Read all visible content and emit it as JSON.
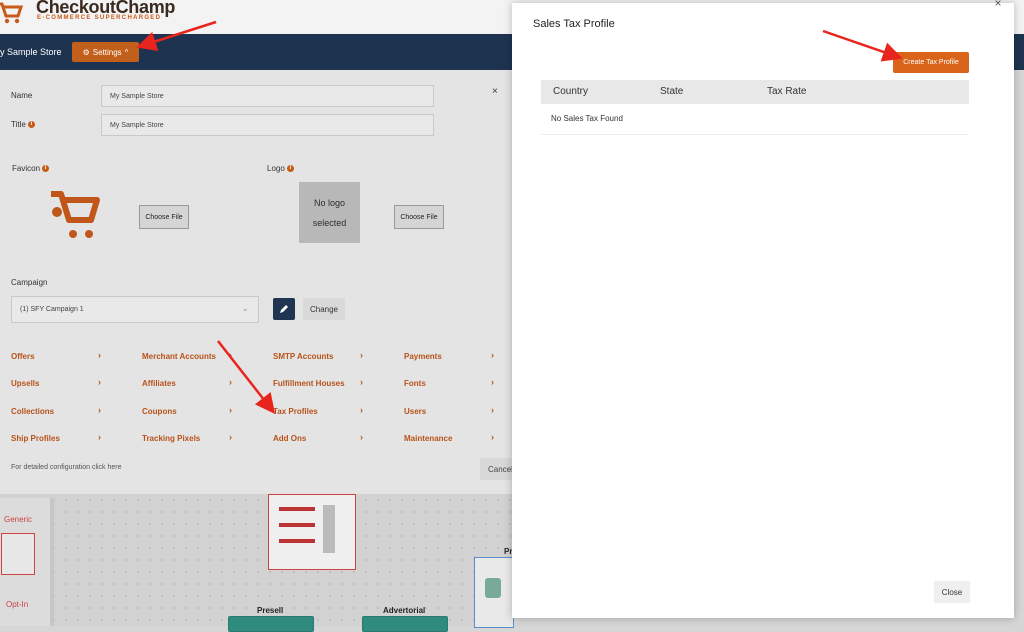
{
  "brand": {
    "name": "CheckoutChamp",
    "tagline": "E-COMMERCE SUPERCHARGED"
  },
  "navbar": {
    "store_name": "y Sample Store",
    "settings_label": "Settings",
    "settings_caret": "^"
  },
  "settings_panel": {
    "name_label": "Name",
    "name_value": "My Sample Store",
    "title_label": "Title",
    "title_value": "My Sample Store",
    "favicon_label": "Favicon",
    "logo_label": "Logo",
    "choose_file_label": "Choose File",
    "no_logo_line1": "No logo",
    "no_logo_line2": "selected",
    "campaign_label": "Campaign",
    "campaign_value": "(1) SFY Campaign 1",
    "change_label": "Change",
    "close_icon": "×",
    "links": [
      "Offers",
      "Merchant Accounts",
      "SMTP Accounts",
      "Payments",
      "Upsells",
      "Affiliates",
      "Fulfillment Houses",
      "Fonts",
      "Collections",
      "Coupons",
      "Tax Profiles",
      "Users",
      "Ship Profiles",
      "Tracking Pixels",
      "Add Ons",
      "Maintenance"
    ],
    "footer_text": "For detailed configuration click here",
    "cancel_label": "Cancel"
  },
  "canvas": {
    "generic_label": "Generic",
    "optin_label": "Opt-In",
    "presell_label": "Presell",
    "advertorial_label": "Advertorial",
    "pr_label": "Pr"
  },
  "modal": {
    "title": "Sales Tax Profile",
    "create_button": "Create Tax Profile",
    "columns": [
      "Country",
      "State",
      "Tax Rate"
    ],
    "empty_text": "No Sales Tax Found",
    "close_button": "Close",
    "close_icon": "×"
  },
  "colors": {
    "accent": "#d9641a",
    "navbar": "#1e3350",
    "annotation": "#e8241c"
  }
}
